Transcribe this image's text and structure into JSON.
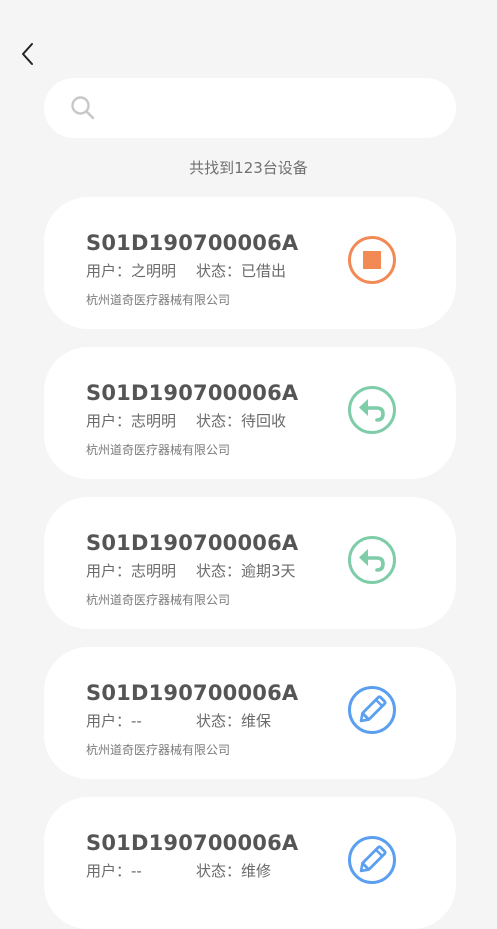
{
  "search": {
    "placeholder": ""
  },
  "result_count": "共找到123台设备",
  "colors": {
    "background": "#f5f5f5",
    "card": "#ffffff",
    "borrowed_orange": "#f28a55",
    "return_green": "#7fcca8",
    "edit_blue": "#5b9ff0"
  },
  "devices": [
    {
      "code": "S01D190700006A",
      "user": "用户：之明明",
      "status": "状态：已借出",
      "company": "杭州道奇医疗器械有限公司",
      "action_icon": "stop-icon"
    },
    {
      "code": "S01D190700006A",
      "user": "用户：志明明",
      "status": "状态：待回收",
      "company": "杭州道奇医疗器械有限公司",
      "action_icon": "return-icon"
    },
    {
      "code": "S01D190700006A",
      "user": "用户：志明明",
      "status": "状态：逾期3天",
      "company": "杭州道奇医疗器械有限公司",
      "action_icon": "return-icon"
    },
    {
      "code": "S01D190700006A",
      "user": "用户：--",
      "status": "状态：维保",
      "company": "杭州道奇医疗器械有限公司",
      "action_icon": "edit-icon"
    },
    {
      "code": "S01D190700006A",
      "user": "用户：--",
      "status": "状态：维修",
      "company": "",
      "action_icon": "edit-icon"
    }
  ]
}
